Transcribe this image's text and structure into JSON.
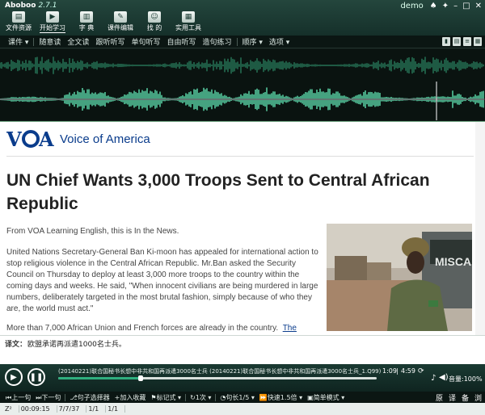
{
  "app": {
    "name": "Aboboo",
    "version": "2.7.1",
    "user": "demo"
  },
  "window_controls": [
    "shirt-icon",
    "pin-icon",
    "minimize-icon",
    "maximize-icon",
    "close-icon"
  ],
  "toolbar": [
    {
      "label": "文件资源",
      "icon": "folder-icon"
    },
    {
      "label": "开始学习",
      "icon": "play-icon"
    },
    {
      "label": "字 典",
      "icon": "book-icon"
    },
    {
      "label": "课件编辑",
      "icon": "edit-icon"
    },
    {
      "label": "找 的",
      "icon": "people-icon"
    },
    {
      "label": "实用工具",
      "icon": "toolbox-icon"
    }
  ],
  "menu": {
    "courseware": "课件",
    "items": [
      "随意读",
      "全文读",
      "跟听听写",
      "单句听写",
      "自由听写",
      "造句练习"
    ],
    "order": "顺序",
    "options": "选项"
  },
  "article": {
    "brand": "Voice of America",
    "headline": "UN Chief Wants 3,000 Troops Sent to Central African Republic",
    "p1": "From VOA Learning English, this is In the News.",
    "p2": "United Nations Secretary-General Ban Ki-moon has appealed for international action to stop religious violence in the Central African Republic.  Mr.Ban asked the Security Council on Thursday to deploy at least 3,000 more troops to the country within the coming days and weeks.  He said, \"When innocent civilians are being murdered in large numbers, deliberately targeted in the most brutal fashion, simply because of who they are, the world must act.\"",
    "p3": "More than 7,000 African Union and French forces are already in the country.",
    "p3_link": "The",
    "photo_sign": "MISCA"
  },
  "translation": {
    "label": "译文：",
    "text": "欧盟承诺再派遣1000名士兵。"
  },
  "player": {
    "track": "(20140221)联合国秘书长想中非共和国再派遣3000名士兵 (20140221)联合国秘书长想中非共和国再派遣3000名士兵_1.Q99)",
    "current": "1:09",
    "total": "4:59",
    "volume_label": "音量:100%",
    "progress": 0.26
  },
  "bottom": {
    "prev": "上一句",
    "next": "下一句",
    "sentence_picker": "句子选择器",
    "add_favorite": "加入收藏",
    "mark_mode": "标记式",
    "repeat": "1次",
    "sentence_gap": "句长1/5",
    "speed": "快速1.5倍",
    "mode": "简单模式",
    "right": [
      "原",
      "译",
      "备",
      "浏"
    ]
  },
  "status": {
    "zoom": "Z²",
    "time": "00:09:15",
    "sentence": "7/7/37",
    "page": "1/1",
    "page2": "1/1"
  },
  "colors": {
    "accent": "#2fae7e",
    "voa_blue": "#0a3c8c",
    "toolbar_bg": "#1a3a32"
  }
}
